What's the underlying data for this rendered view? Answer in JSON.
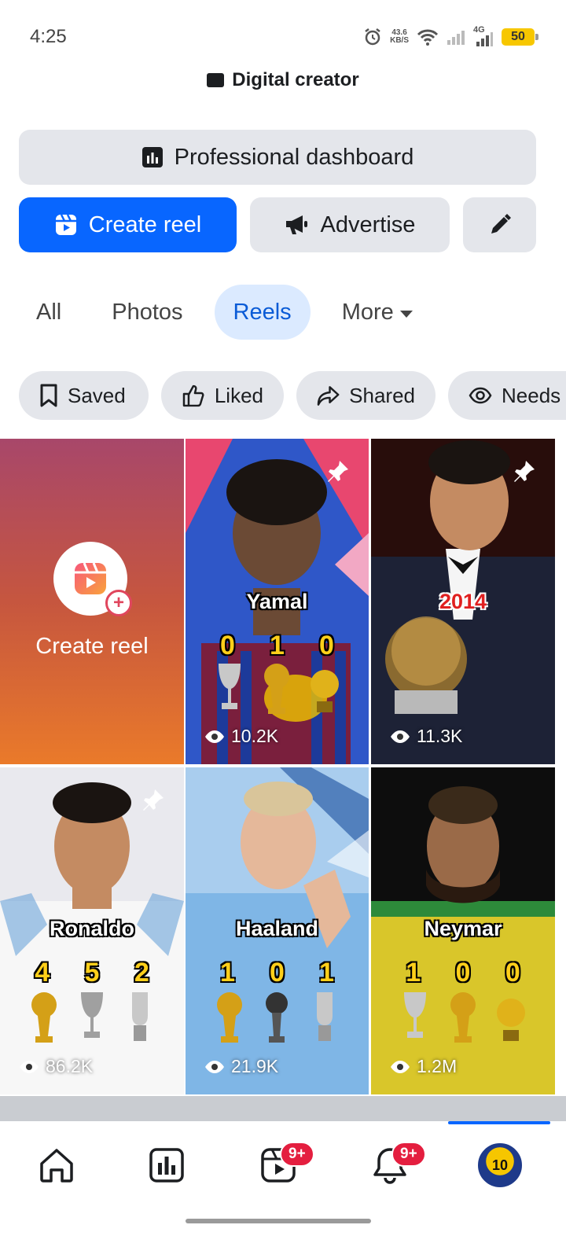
{
  "status_bar": {
    "time": "4:25",
    "net_speed_value": "43.6",
    "net_speed_unit": "KB/S",
    "network": "4G",
    "battery": "50"
  },
  "profile": {
    "category": "Digital creator"
  },
  "actions": {
    "professional_dashboard": "Professional dashboard",
    "create_reel": "Create reel",
    "advertise": "Advertise"
  },
  "tabs": [
    {
      "label": "All"
    },
    {
      "label": "Photos"
    },
    {
      "label": "Reels",
      "active": true
    },
    {
      "label": "More"
    }
  ],
  "chips": [
    {
      "label": "Saved",
      "icon": "bookmark-icon"
    },
    {
      "label": "Liked",
      "icon": "thumbs-up-icon"
    },
    {
      "label": "Shared",
      "icon": "share-icon"
    },
    {
      "label": "Needs",
      "icon": "eye-icon"
    }
  ],
  "grid": {
    "create_tile_label": "Create reel",
    "reels": [
      {
        "name": "Yamal",
        "stats": [
          "0",
          "1",
          "0"
        ],
        "views": "10.2K",
        "pinned": true
      },
      {
        "name": "2014",
        "stats": [],
        "views": "11.3K",
        "pinned": true
      },
      {
        "name": "Ronaldo",
        "stats": [
          "4",
          "5",
          "2"
        ],
        "views": "86.2K",
        "pinned": true
      },
      {
        "name": "Haaland",
        "stats": [
          "1",
          "0",
          "1"
        ],
        "views": "21.9K",
        "pinned": false
      },
      {
        "name": "Neymar",
        "stats": [
          "1",
          "0",
          "0"
        ],
        "views": "1.2M",
        "pinned": false
      }
    ]
  },
  "bottom_nav": {
    "items": [
      "home",
      "dashboard",
      "reels",
      "notifications",
      "profile"
    ],
    "reels_badge": "9+",
    "notifications_badge": "9+",
    "avatar_text": "10"
  },
  "colors": {
    "primary_blue": "#0866ff",
    "chip_grey": "#e4e6eb",
    "badge_red": "#e41e3f",
    "stat_gold": "#ffcf1a"
  }
}
